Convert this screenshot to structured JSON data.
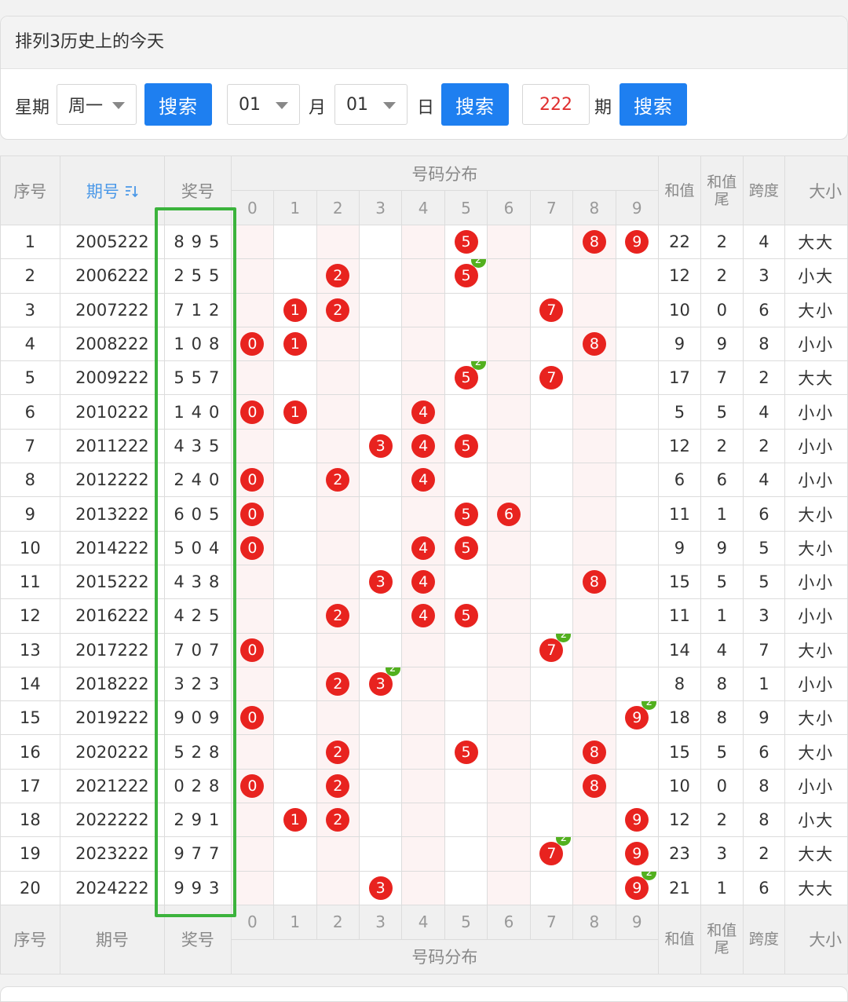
{
  "panel": {
    "title": "排列3历史上的今天",
    "weekday_label": "星期",
    "weekday_value": "周一",
    "search_label": "搜索",
    "month_value": "01",
    "month_label": "月",
    "day_value": "01",
    "day_label": "日",
    "period_value": "222",
    "period_label": "期"
  },
  "table": {
    "headers": {
      "seq": "序号",
      "period": "期号",
      "award": "奖号",
      "dist": "号码分布",
      "sum": "和值",
      "sum_tail": "和值尾",
      "span": "跨度",
      "size": "大小"
    },
    "digits": [
      "0",
      "1",
      "2",
      "3",
      "4",
      "5",
      "6",
      "7",
      "8",
      "9"
    ],
    "rows": [
      {
        "seq": "1",
        "period": "2005222",
        "award": "895",
        "sum": "22",
        "tail": "2",
        "span": "4",
        "size": "大大"
      },
      {
        "seq": "2",
        "period": "2006222",
        "award": "255",
        "sum": "12",
        "tail": "2",
        "span": "3",
        "size": "小大"
      },
      {
        "seq": "3",
        "period": "2007222",
        "award": "712",
        "sum": "10",
        "tail": "0",
        "span": "6",
        "size": "大小"
      },
      {
        "seq": "4",
        "period": "2008222",
        "award": "108",
        "sum": "9",
        "tail": "9",
        "span": "8",
        "size": "小小"
      },
      {
        "seq": "5",
        "period": "2009222",
        "award": "557",
        "sum": "17",
        "tail": "7",
        "span": "2",
        "size": "大大"
      },
      {
        "seq": "6",
        "period": "2010222",
        "award": "140",
        "sum": "5",
        "tail": "5",
        "span": "4",
        "size": "小小"
      },
      {
        "seq": "7",
        "period": "2011222",
        "award": "435",
        "sum": "12",
        "tail": "2",
        "span": "2",
        "size": "小小"
      },
      {
        "seq": "8",
        "period": "2012222",
        "award": "240",
        "sum": "6",
        "tail": "6",
        "span": "4",
        "size": "小小"
      },
      {
        "seq": "9",
        "period": "2013222",
        "award": "605",
        "sum": "11",
        "tail": "1",
        "span": "6",
        "size": "大小"
      },
      {
        "seq": "10",
        "period": "2014222",
        "award": "504",
        "sum": "9",
        "tail": "9",
        "span": "5",
        "size": "大小"
      },
      {
        "seq": "11",
        "period": "2015222",
        "award": "438",
        "sum": "15",
        "tail": "5",
        "span": "5",
        "size": "小小"
      },
      {
        "seq": "12",
        "period": "2016222",
        "award": "425",
        "sum": "11",
        "tail": "1",
        "span": "3",
        "size": "小小"
      },
      {
        "seq": "13",
        "period": "2017222",
        "award": "707",
        "sum": "14",
        "tail": "4",
        "span": "7",
        "size": "大小"
      },
      {
        "seq": "14",
        "period": "2018222",
        "award": "323",
        "sum": "8",
        "tail": "8",
        "span": "1",
        "size": "小小"
      },
      {
        "seq": "15",
        "period": "2019222",
        "award": "909",
        "sum": "18",
        "tail": "8",
        "span": "9",
        "size": "大小"
      },
      {
        "seq": "16",
        "period": "2020222",
        "award": "528",
        "sum": "15",
        "tail": "5",
        "span": "6",
        "size": "大小"
      },
      {
        "seq": "17",
        "period": "2021222",
        "award": "028",
        "sum": "10",
        "tail": "0",
        "span": "8",
        "size": "小小"
      },
      {
        "seq": "18",
        "period": "2022222",
        "award": "291",
        "sum": "12",
        "tail": "2",
        "span": "8",
        "size": "小大"
      },
      {
        "seq": "19",
        "period": "2023222",
        "award": "977",
        "sum": "23",
        "tail": "3",
        "span": "2",
        "size": "大大"
      },
      {
        "seq": "20",
        "period": "2024222",
        "award": "993",
        "sum": "21",
        "tail": "1",
        "span": "6",
        "size": "大大"
      }
    ]
  },
  "colors": {
    "ball": "#e8231f",
    "repeat_badge": "#52b01e",
    "button": "#1e7ff0",
    "highlight_box": "#3bb33c",
    "award_text": "#e03030"
  }
}
